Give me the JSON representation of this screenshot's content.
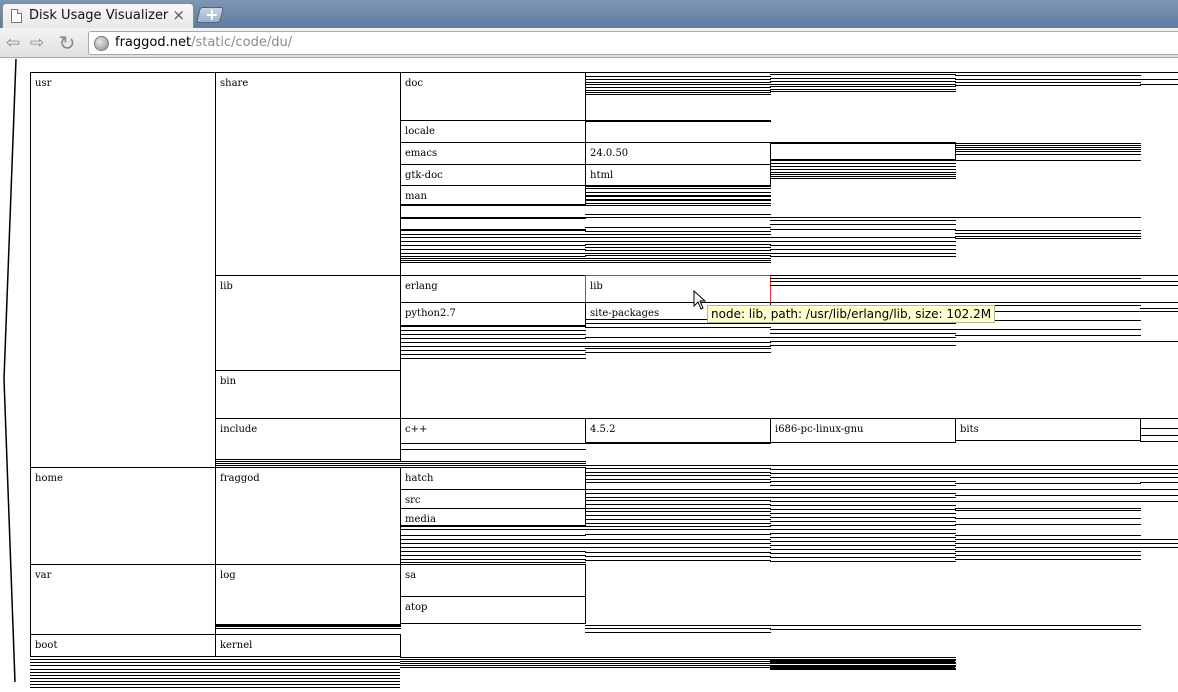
{
  "browser": {
    "tab_title": "Disk Usage Visualizer",
    "tab_close": "×",
    "new_tab": "+",
    "back": "⇦",
    "forward": "⇨",
    "reload": "↻",
    "url_host": "fraggod.net",
    "url_path": "/static/code/du/"
  },
  "tree": {
    "level1": [
      "usr",
      "home",
      "var",
      "boot"
    ],
    "level2": [
      "share",
      "lib",
      "bin",
      "include",
      "fraggod",
      "log",
      "kernel"
    ],
    "level3": [
      "doc",
      "locale",
      "emacs",
      "gtk-doc",
      "man",
      "erlang",
      "python2.7",
      "c++",
      "hatch",
      "src",
      "media",
      "sa",
      "atop"
    ],
    "level4": [
      "24.0.50",
      "html",
      "lib",
      "site-packages",
      "4.5.2"
    ],
    "level5": [
      "i686-pc-linux-gnu"
    ],
    "level6": [
      "bits"
    ]
  },
  "tooltip": "node: lib, path: /usr/lib/erlang/lib, size: 102.2M"
}
